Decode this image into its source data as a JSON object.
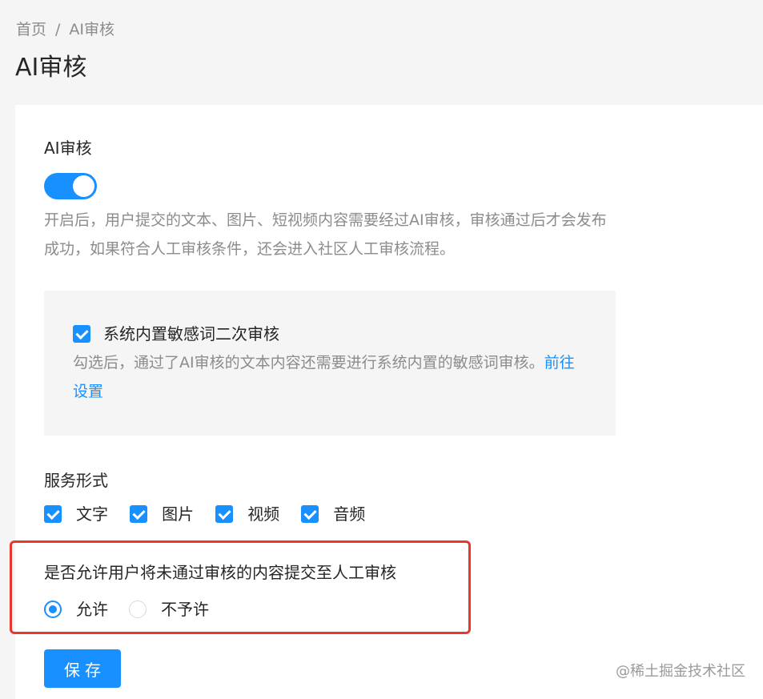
{
  "breadcrumb": {
    "home": "首页",
    "separator": "/",
    "current": "AI审核"
  },
  "page_title": "AI审核",
  "ai_review": {
    "label": "AI审核",
    "switch_on": true,
    "description": "开启后，用户提交的文本、图片、短视频内容需要经过AI审核，审核通过后才会发布成功，如果符合人工审核条件，还会进入社区人工审核流程。"
  },
  "sensitive_words": {
    "checked": true,
    "label": "系统内置敏感词二次审核",
    "description": "勾选后，通过了AI审核的文本内容还需要进行系统内置的敏感词审核。",
    "link_text": "前往设置"
  },
  "service_form": {
    "label": "服务形式",
    "options": [
      {
        "label": "文字",
        "checked": true
      },
      {
        "label": "图片",
        "checked": true
      },
      {
        "label": "视频",
        "checked": true
      },
      {
        "label": "音频",
        "checked": true
      }
    ]
  },
  "manual_review": {
    "question": "是否允许用户将未通过审核的内容提交至人工审核",
    "options": [
      {
        "label": "允许",
        "checked": true
      },
      {
        "label": "不予许",
        "checked": false
      }
    ]
  },
  "save_label": "保存",
  "watermark": "@稀土掘金技术社区",
  "colors": {
    "primary": "#1890ff",
    "highlight_border": "#e8372f",
    "muted_text": "#8c8c8c"
  }
}
